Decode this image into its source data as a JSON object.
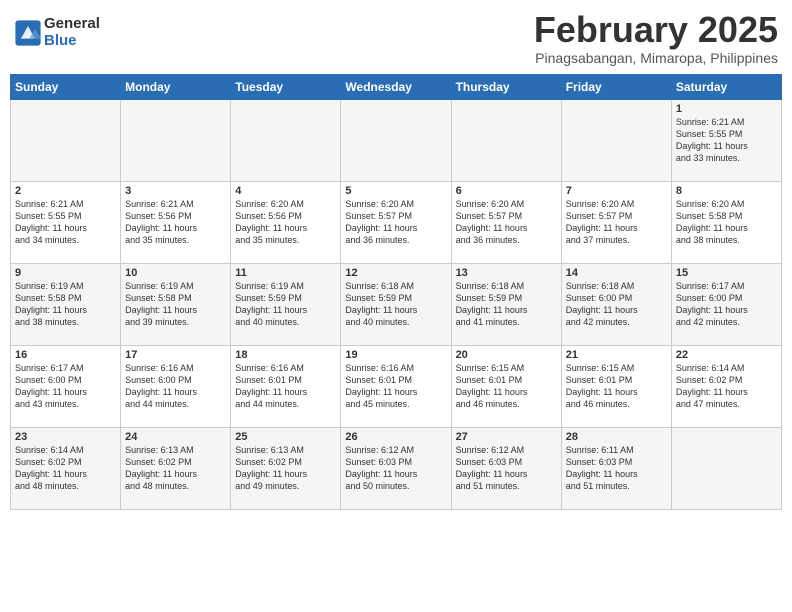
{
  "header": {
    "logo_general": "General",
    "logo_blue": "Blue",
    "month_title": "February 2025",
    "location": "Pinagsabangan, Mimaropa, Philippines"
  },
  "weekdays": [
    "Sunday",
    "Monday",
    "Tuesday",
    "Wednesday",
    "Thursday",
    "Friday",
    "Saturday"
  ],
  "weeks": [
    [
      {
        "day": "",
        "info": ""
      },
      {
        "day": "",
        "info": ""
      },
      {
        "day": "",
        "info": ""
      },
      {
        "day": "",
        "info": ""
      },
      {
        "day": "",
        "info": ""
      },
      {
        "day": "",
        "info": ""
      },
      {
        "day": "1",
        "info": "Sunrise: 6:21 AM\nSunset: 5:55 PM\nDaylight: 11 hours\nand 33 minutes."
      }
    ],
    [
      {
        "day": "2",
        "info": "Sunrise: 6:21 AM\nSunset: 5:55 PM\nDaylight: 11 hours\nand 34 minutes."
      },
      {
        "day": "3",
        "info": "Sunrise: 6:21 AM\nSunset: 5:56 PM\nDaylight: 11 hours\nand 35 minutes."
      },
      {
        "day": "4",
        "info": "Sunrise: 6:20 AM\nSunset: 5:56 PM\nDaylight: 11 hours\nand 35 minutes."
      },
      {
        "day": "5",
        "info": "Sunrise: 6:20 AM\nSunset: 5:57 PM\nDaylight: 11 hours\nand 36 minutes."
      },
      {
        "day": "6",
        "info": "Sunrise: 6:20 AM\nSunset: 5:57 PM\nDaylight: 11 hours\nand 36 minutes."
      },
      {
        "day": "7",
        "info": "Sunrise: 6:20 AM\nSunset: 5:57 PM\nDaylight: 11 hours\nand 37 minutes."
      },
      {
        "day": "8",
        "info": "Sunrise: 6:20 AM\nSunset: 5:58 PM\nDaylight: 11 hours\nand 38 minutes."
      }
    ],
    [
      {
        "day": "9",
        "info": "Sunrise: 6:19 AM\nSunset: 5:58 PM\nDaylight: 11 hours\nand 38 minutes."
      },
      {
        "day": "10",
        "info": "Sunrise: 6:19 AM\nSunset: 5:58 PM\nDaylight: 11 hours\nand 39 minutes."
      },
      {
        "day": "11",
        "info": "Sunrise: 6:19 AM\nSunset: 5:59 PM\nDaylight: 11 hours\nand 40 minutes."
      },
      {
        "day": "12",
        "info": "Sunrise: 6:18 AM\nSunset: 5:59 PM\nDaylight: 11 hours\nand 40 minutes."
      },
      {
        "day": "13",
        "info": "Sunrise: 6:18 AM\nSunset: 5:59 PM\nDaylight: 11 hours\nand 41 minutes."
      },
      {
        "day": "14",
        "info": "Sunrise: 6:18 AM\nSunset: 6:00 PM\nDaylight: 11 hours\nand 42 minutes."
      },
      {
        "day": "15",
        "info": "Sunrise: 6:17 AM\nSunset: 6:00 PM\nDaylight: 11 hours\nand 42 minutes."
      }
    ],
    [
      {
        "day": "16",
        "info": "Sunrise: 6:17 AM\nSunset: 6:00 PM\nDaylight: 11 hours\nand 43 minutes."
      },
      {
        "day": "17",
        "info": "Sunrise: 6:16 AM\nSunset: 6:00 PM\nDaylight: 11 hours\nand 44 minutes."
      },
      {
        "day": "18",
        "info": "Sunrise: 6:16 AM\nSunset: 6:01 PM\nDaylight: 11 hours\nand 44 minutes."
      },
      {
        "day": "19",
        "info": "Sunrise: 6:16 AM\nSunset: 6:01 PM\nDaylight: 11 hours\nand 45 minutes."
      },
      {
        "day": "20",
        "info": "Sunrise: 6:15 AM\nSunset: 6:01 PM\nDaylight: 11 hours\nand 46 minutes."
      },
      {
        "day": "21",
        "info": "Sunrise: 6:15 AM\nSunset: 6:01 PM\nDaylight: 11 hours\nand 46 minutes."
      },
      {
        "day": "22",
        "info": "Sunrise: 6:14 AM\nSunset: 6:02 PM\nDaylight: 11 hours\nand 47 minutes."
      }
    ],
    [
      {
        "day": "23",
        "info": "Sunrise: 6:14 AM\nSunset: 6:02 PM\nDaylight: 11 hours\nand 48 minutes."
      },
      {
        "day": "24",
        "info": "Sunrise: 6:13 AM\nSunset: 6:02 PM\nDaylight: 11 hours\nand 48 minutes."
      },
      {
        "day": "25",
        "info": "Sunrise: 6:13 AM\nSunset: 6:02 PM\nDaylight: 11 hours\nand 49 minutes."
      },
      {
        "day": "26",
        "info": "Sunrise: 6:12 AM\nSunset: 6:03 PM\nDaylight: 11 hours\nand 50 minutes."
      },
      {
        "day": "27",
        "info": "Sunrise: 6:12 AM\nSunset: 6:03 PM\nDaylight: 11 hours\nand 51 minutes."
      },
      {
        "day": "28",
        "info": "Sunrise: 6:11 AM\nSunset: 6:03 PM\nDaylight: 11 hours\nand 51 minutes."
      },
      {
        "day": "",
        "info": ""
      }
    ]
  ]
}
